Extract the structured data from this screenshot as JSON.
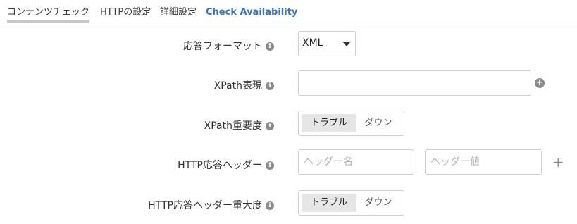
{
  "tabs": [
    {
      "label": "コンテンツチェック"
    },
    {
      "label": "HTTPの設定"
    },
    {
      "label": "詳細設定"
    },
    {
      "label": "Check Availability"
    }
  ],
  "info_icon_glyph": "i",
  "form": {
    "response_format": {
      "label": "応答フォーマット",
      "value": "XML",
      "options": [
        "XML"
      ]
    },
    "xpath_expression": {
      "label": "XPath表現",
      "value": "",
      "add_symbol": "+"
    },
    "xpath_severity": {
      "label": "XPath重要度",
      "options": [
        "トラブル",
        "ダウン"
      ],
      "selected": "トラブル"
    },
    "http_response_header": {
      "label": "HTTP応答ヘッダー",
      "name_placeholder": "ヘッダー名",
      "value_placeholder": "ヘッダー値",
      "add_symbol": "+"
    },
    "http_header_severity": {
      "label": "HTTP応答ヘッダー重大度",
      "options": [
        "トラブル",
        "ダウン"
      ],
      "selected": "トラブル"
    }
  },
  "colors": {
    "link": "#3b73b9",
    "icon": "#8a8a8a",
    "border": "#cfcfcf",
    "selected_bg": "#e6e6e6"
  },
  "icons": {
    "info": "info-icon",
    "add": "plus-icon",
    "dropdown": "caret-down-icon"
  }
}
